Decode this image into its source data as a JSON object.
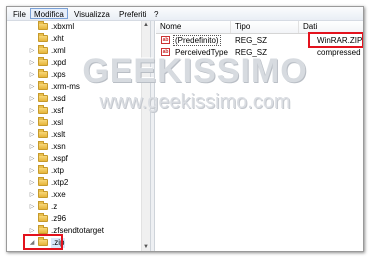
{
  "menu": {
    "items": [
      {
        "label": "File"
      },
      {
        "label": "Modifica"
      },
      {
        "label": "Visualizza"
      },
      {
        "label": "Preferiti"
      },
      {
        "label": "?"
      }
    ]
  },
  "tree": {
    "items": [
      {
        "label": ".xbxml",
        "expander": ""
      },
      {
        "label": ".xht",
        "expander": ""
      },
      {
        "label": ".xml",
        "expander": "▷"
      },
      {
        "label": ".xpd",
        "expander": "▷"
      },
      {
        "label": ".xps",
        "expander": "▷"
      },
      {
        "label": ".xrm-ms",
        "expander": "▷"
      },
      {
        "label": ".xsd",
        "expander": "▷"
      },
      {
        "label": ".xsf",
        "expander": "▷"
      },
      {
        "label": ".xsl",
        "expander": "▷"
      },
      {
        "label": ".xslt",
        "expander": "▷"
      },
      {
        "label": ".xsn",
        "expander": "▷"
      },
      {
        "label": ".xspf",
        "expander": "▷"
      },
      {
        "label": ".xtp",
        "expander": "▷"
      },
      {
        "label": ".xtp2",
        "expander": "▷"
      },
      {
        "label": ".xxe",
        "expander": "▷"
      },
      {
        "label": ".z",
        "expander": "▷"
      },
      {
        "label": ".z96",
        "expander": ""
      },
      {
        "label": ".zfsendtotarget",
        "expander": "▷"
      },
      {
        "label": ".zip",
        "expander": "◢"
      }
    ]
  },
  "values_pane": {
    "headers": {
      "name": "Nome",
      "type": "Tipo",
      "data": "Dati"
    },
    "rows": [
      {
        "name": "(Predefinito)",
        "type": "REG_SZ",
        "data": "WinRAR.ZIP"
      },
      {
        "name": "PerceivedType",
        "type": "REG_SZ",
        "data": "compressed"
      }
    ]
  },
  "watermark": {
    "title": "GEEKISSIMO",
    "url": "www.geekissimo.com"
  },
  "colors": {
    "highlight": "#e3121d",
    "folder": "#e6b53a",
    "selection": "#d9e8fb"
  }
}
